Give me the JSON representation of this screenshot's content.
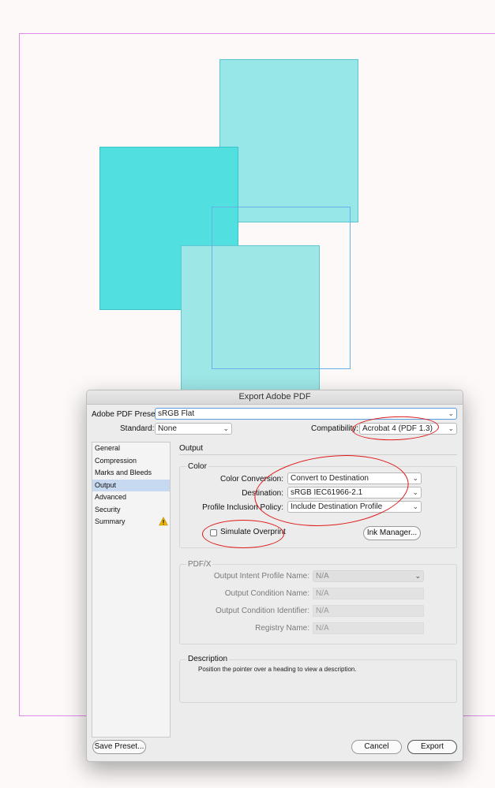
{
  "dialog": {
    "title": "Export Adobe PDF",
    "preset_label": "Adobe PDF Preset:",
    "preset_value": "sRGB Flat",
    "standard_label": "Standard:",
    "standard_value": "None",
    "compatibility_label": "Compatibility:",
    "compatibility_value": "Acrobat 4 (PDF 1.3)"
  },
  "sidebar": {
    "items": [
      {
        "label": "General"
      },
      {
        "label": "Compression"
      },
      {
        "label": "Marks and Bleeds"
      },
      {
        "label": "Output"
      },
      {
        "label": "Advanced"
      },
      {
        "label": "Security"
      },
      {
        "label": "Summary"
      }
    ],
    "selected": "Output",
    "summary_badge": "warning-icon"
  },
  "panel": {
    "title": "Output",
    "color": {
      "group_title": "Color",
      "conversion_label": "Color Conversion:",
      "conversion_value": "Convert to Destination",
      "destination_label": "Destination:",
      "destination_value": "sRGB IEC61966-2.1",
      "profile_label": "Profile Inclusion Policy:",
      "profile_value": "Include Destination Profile",
      "overprint_label": "Simulate Overprint",
      "overprint_checked": false,
      "ink_manager_label": "Ink Manager..."
    },
    "pdfx": {
      "group_title": "PDF/X",
      "intent_label": "Output Intent Profile Name:",
      "intent_value": "N/A",
      "condition_label": "Output Condition Name:",
      "condition_value": "N/A",
      "identifier_label": "Output Condition Identifier:",
      "identifier_value": "N/A",
      "registry_label": "Registry Name:",
      "registry_value": "N/A"
    },
    "description": {
      "group_title": "Description",
      "text": "Position the pointer over a heading to view a description."
    }
  },
  "footer": {
    "save_preset_label": "Save Preset...",
    "cancel_label": "Cancel",
    "export_label": "Export"
  },
  "colors": {
    "highlight_ring": "#e01818",
    "selected_item": "#c6d9f0",
    "square_dark": "#52dfdf",
    "square_light": "#97e6e8",
    "page_border": "#e08ae8"
  }
}
